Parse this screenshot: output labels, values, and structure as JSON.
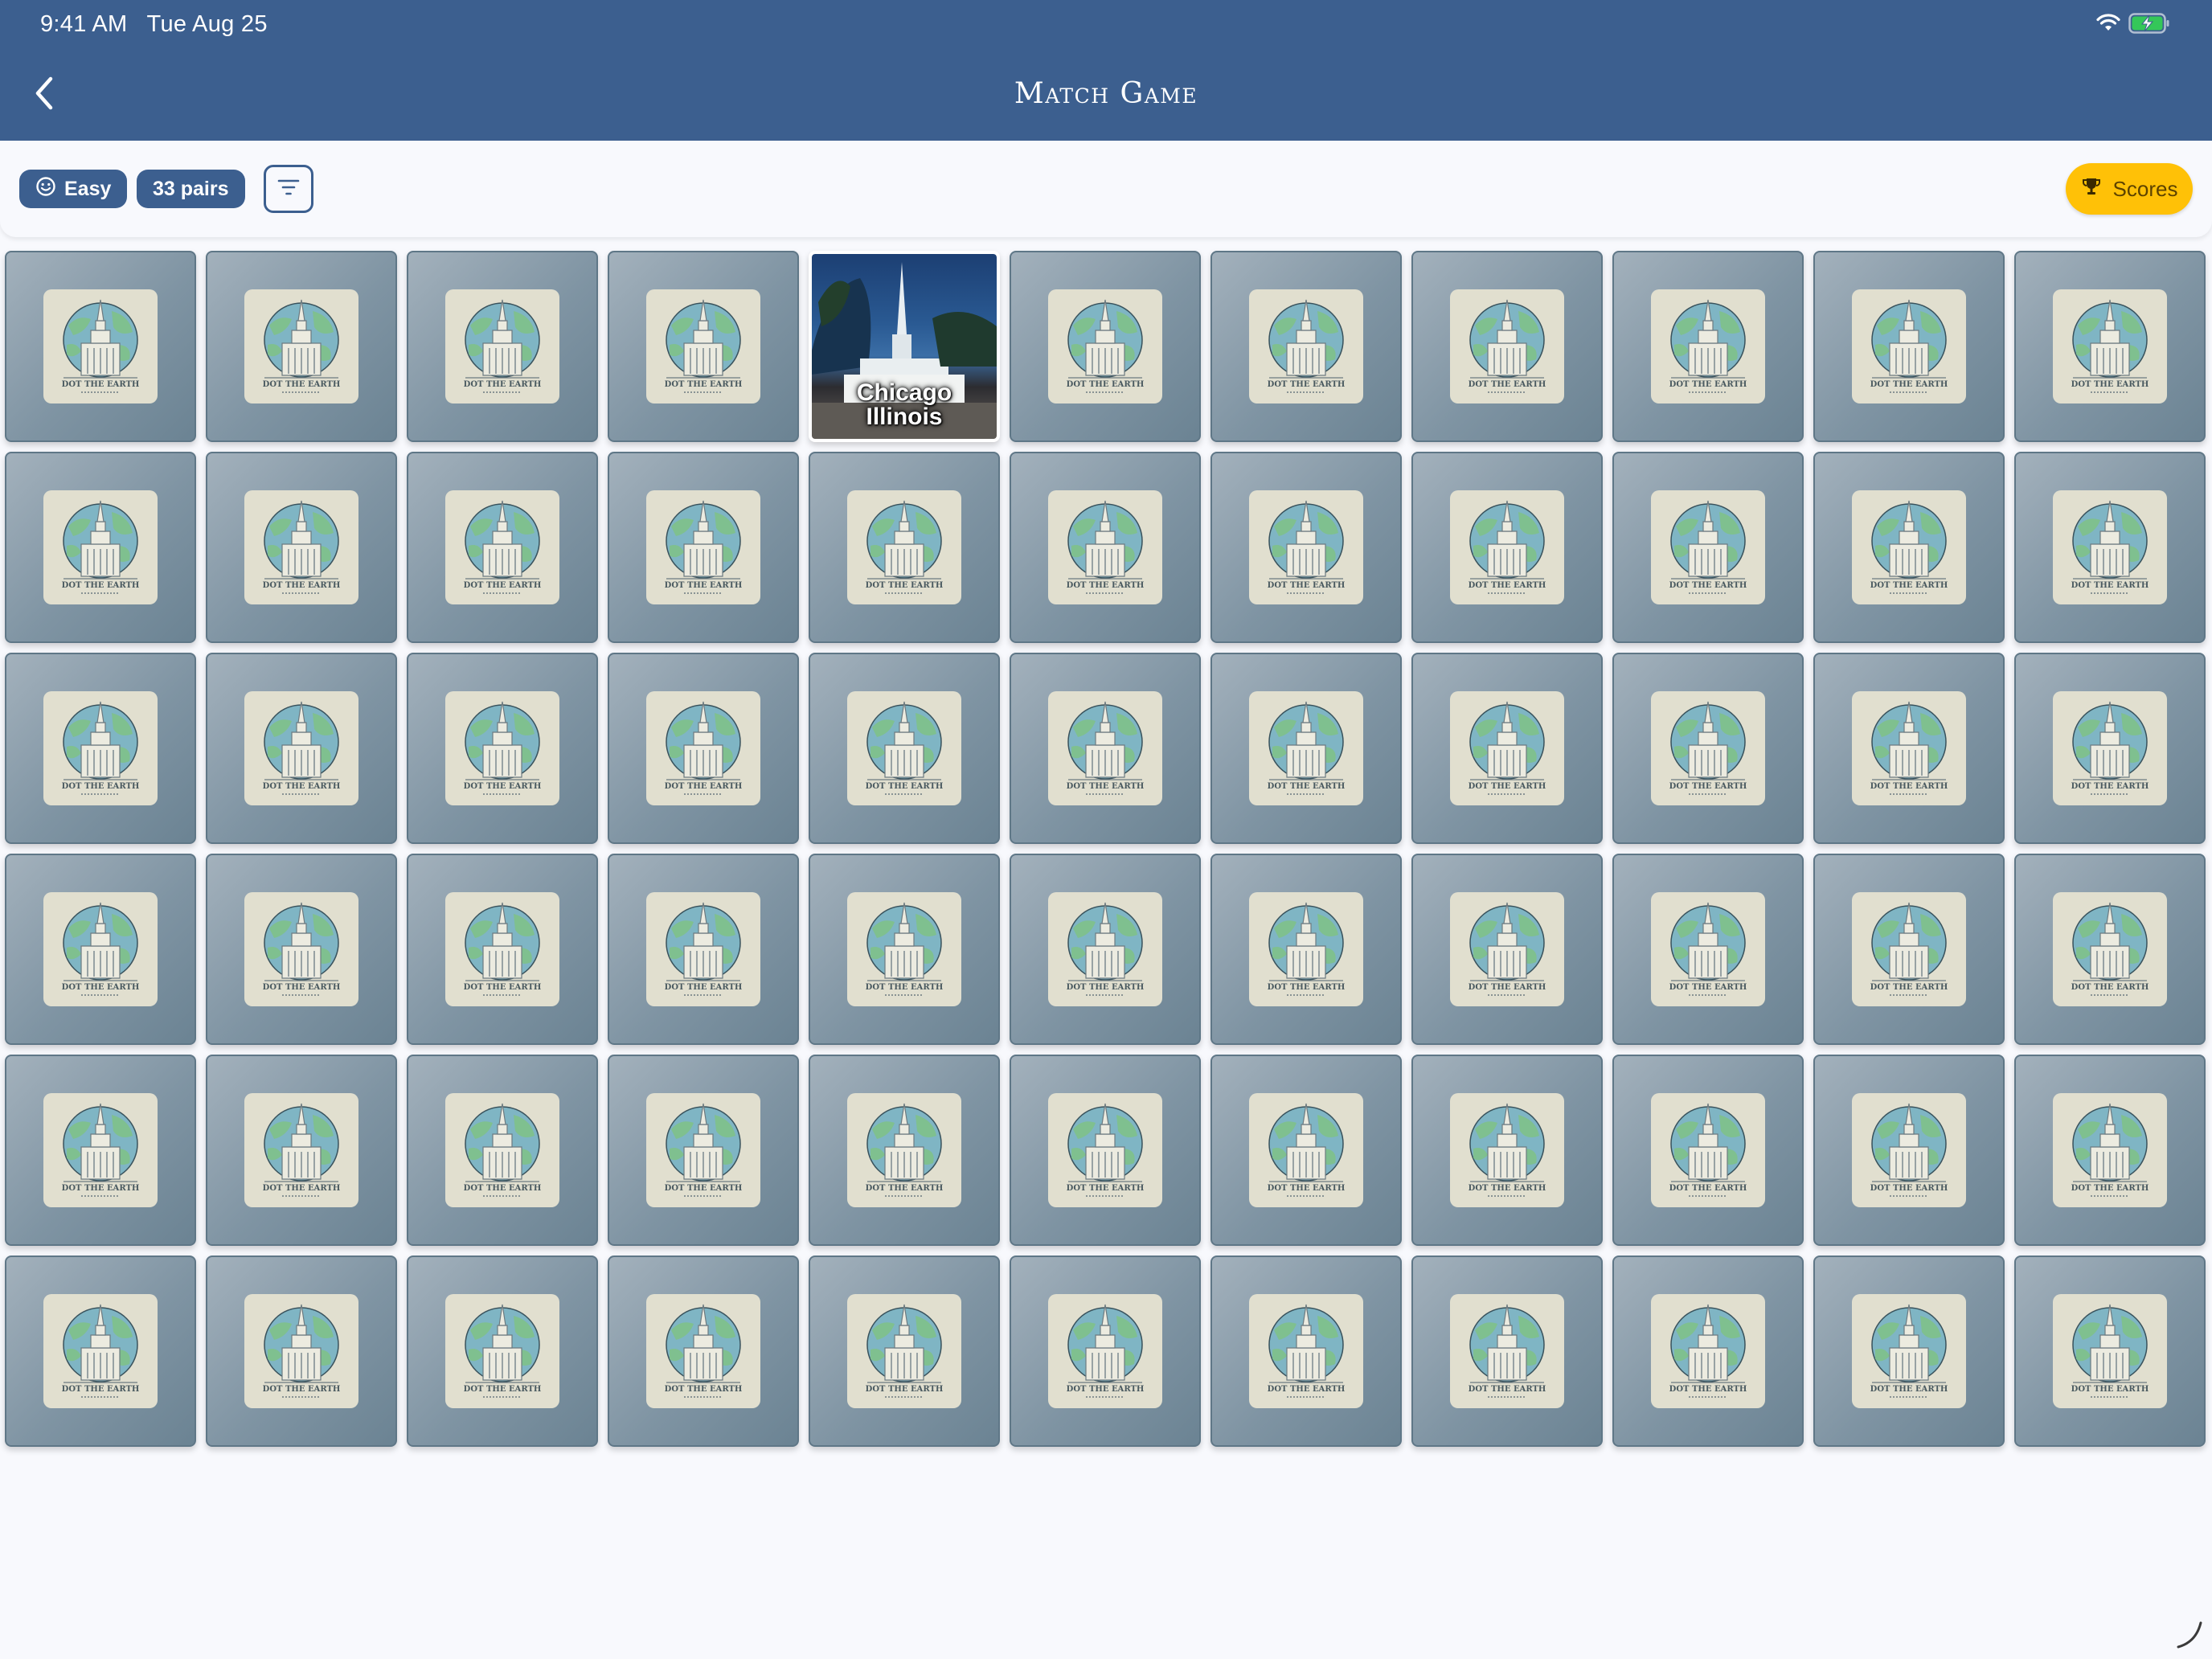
{
  "status_bar": {
    "time": "9:41 AM",
    "date": "Tue Aug 25"
  },
  "header": {
    "title": "Match Game"
  },
  "toolbar": {
    "difficulty_label": "Easy",
    "pairs_label": "33 pairs",
    "scores_label": "Scores"
  },
  "grid": {
    "columns": 11,
    "rows": 6,
    "card_back_text": "DOT THE EARTH",
    "revealed_card": {
      "row": 0,
      "col": 4,
      "line1": "Chicago",
      "line2": "Illinois"
    }
  },
  "colors": {
    "header_bg": "#3c5f8f",
    "accent": "#3c5f8f",
    "scores_bg": "#ffc107",
    "card_back": "#7f94a3"
  },
  "icons": {
    "back": "chevron-left-icon",
    "difficulty": "smiley-icon",
    "filter": "filter-icon",
    "scores": "trophy-icon",
    "wifi": "wifi-icon",
    "battery": "battery-charging-icon"
  }
}
